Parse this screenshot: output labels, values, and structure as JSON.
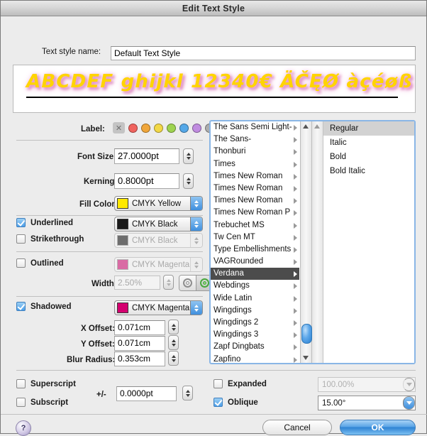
{
  "window": {
    "title": "Edit Text Style"
  },
  "style_name": {
    "label": "Text style name:",
    "value": "Default Text Style"
  },
  "preview": {
    "sample": "ABCDEF ghijkl 12340€ ÄČĘØ  àçéøß"
  },
  "label_field": {
    "label": "Label:",
    "none": "✕",
    "colors": [
      "#f0635e",
      "#f0a63a",
      "#f2d846",
      "#9ed34f",
      "#55a8e8",
      "#c08ce0",
      "#adadad"
    ]
  },
  "font_size": {
    "label": "Font Size:",
    "value": "27.0000pt"
  },
  "kerning": {
    "label": "Kerning:",
    "value": "0.8000pt"
  },
  "fill_color": {
    "label": "Fill Color:",
    "value": "CMYK Yellow",
    "swatch": "#ffe900"
  },
  "underlined": {
    "label": "Underlined",
    "checked": true,
    "color": "CMYK Black",
    "swatch": "#1a1a1a"
  },
  "strikethrough": {
    "label": "Strikethrough",
    "checked": false,
    "color": "CMYK Black",
    "swatch": "#6e6e6e"
  },
  "outlined": {
    "label": "Outlined",
    "checked": false,
    "color": "CMYK Magenta",
    "swatch": "#d96ba4"
  },
  "outline_width": {
    "label": "Width:",
    "value": "2.50%"
  },
  "shadowed": {
    "label": "Shadowed",
    "checked": true,
    "color": "CMYK Magenta",
    "swatch": "#d4006f"
  },
  "x_offset": {
    "label": "X Offset:",
    "value": "0.071cm"
  },
  "y_offset": {
    "label": "Y Offset:",
    "value": "0.071cm"
  },
  "blur_radius": {
    "label": "Blur Radius:",
    "value": "0.353cm"
  },
  "superscript": {
    "label": "Superscript",
    "checked": false
  },
  "subscript": {
    "label": "Subscript",
    "checked": false
  },
  "plus_minus": {
    "label": "+/-",
    "value": "0.0000pt"
  },
  "expanded": {
    "label": "Expanded",
    "checked": false,
    "value": "100.00%"
  },
  "oblique": {
    "label": "Oblique",
    "checked": true,
    "value": "15.00°"
  },
  "font_list": {
    "items": [
      "The Sans Semi Light-",
      "The Sans-",
      "Thonburi",
      "Times",
      "Times New Roman",
      "Times New Roman",
      "Times New Roman",
      "Times New Roman P",
      "Trebuchet MS",
      "Tw Cen MT",
      "Type Embellishments",
      "VAGRounded",
      "Verdana",
      "Webdings",
      "Wide Latin",
      "Wingdings",
      "Wingdings 2",
      "Wingdings 3",
      "Zapf Dingbats",
      "Zapfino"
    ],
    "selected": "Verdana"
  },
  "style_list": {
    "items": [
      "Regular",
      "Italic",
      "Bold",
      "Bold Italic"
    ],
    "selected": "Regular"
  },
  "buttons": {
    "help": "?",
    "cancel": "Cancel",
    "ok": "OK"
  }
}
